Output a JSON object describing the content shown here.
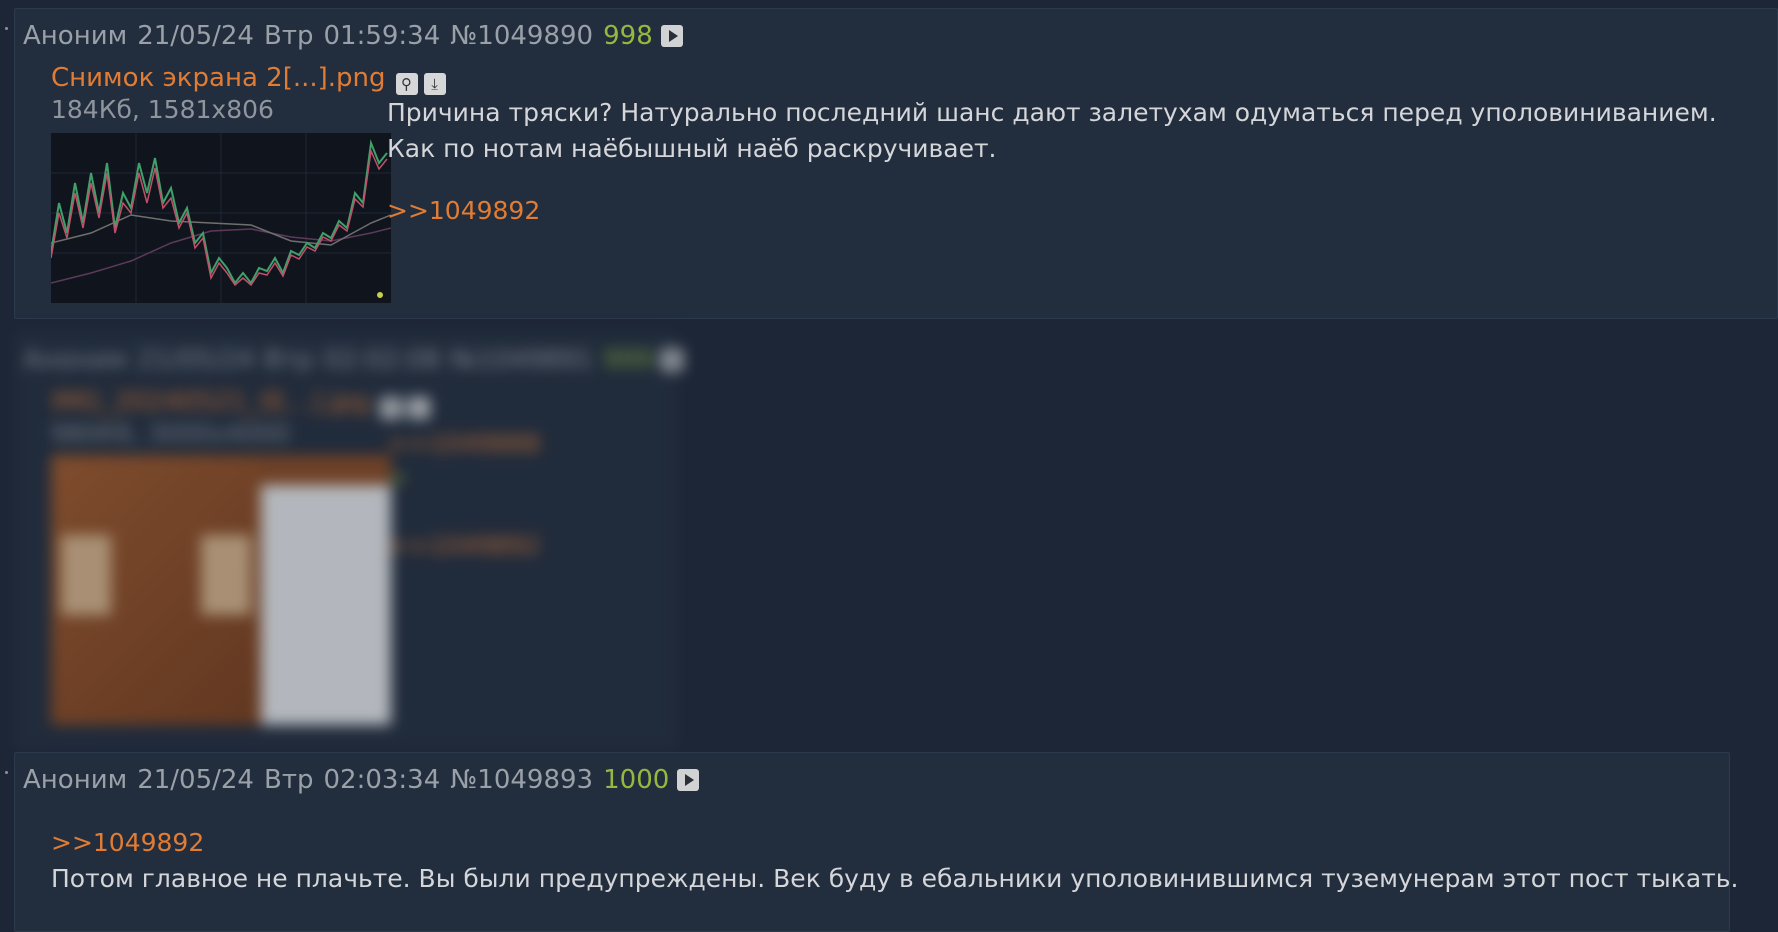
{
  "posts": [
    {
      "author": "Аноним",
      "date": "21/05/24",
      "weekday": "Втр",
      "time": "01:59:34",
      "number": "№1049890",
      "count": "998",
      "file": {
        "name": "Снимок экрана 2[...].png",
        "meta": "184Кб, 1581x806"
      },
      "text_lines": [
        "Причина тряски? Натурально последний шанс дают залетухам одуматься перед уполовиниванием.",
        "Как по нотам наёбышный наёб раскручивает."
      ],
      "reply_link": ">>1049892"
    },
    {
      "author": "Аноним",
      "date": "21/05/24",
      "weekday": "Втр",
      "time": "02:02:08",
      "number": "№1049891",
      "count": "999",
      "file": {
        "name": "IMG_20240521_0[...].jpg",
        "meta": "980Кб, 3000x4000"
      },
      "links": [
        ">>1049888",
        ">",
        ">>1049892"
      ]
    },
    {
      "author": "Аноним",
      "date": "21/05/24",
      "weekday": "Втр",
      "time": "02:03:34",
      "number": "№1049893",
      "count": "1000",
      "reply_link": ">>1049892",
      "text_lines": [
        "Потом главное не плачьте. Вы были предупреждены. Век буду в ебальники уполовинившимся туземунерам этот пост тыкать."
      ]
    }
  ],
  "colors": {
    "background": "#1c2636",
    "post_bg": "#222d3d",
    "accent_link": "#e07c34",
    "count_green": "#97b840"
  },
  "icons": {
    "play": "play-icon",
    "search": "search-icon",
    "download": "download-icon"
  }
}
